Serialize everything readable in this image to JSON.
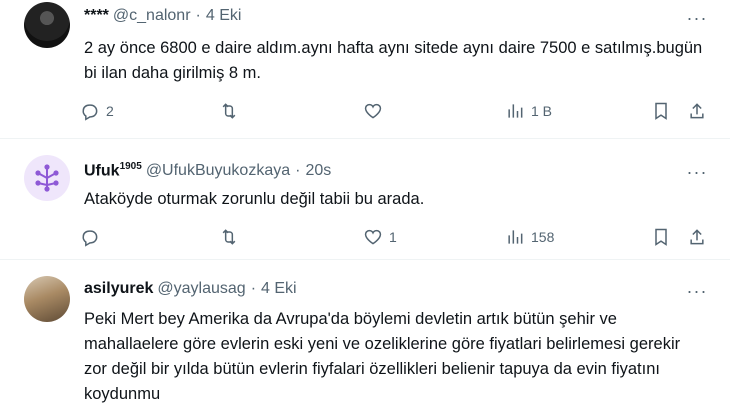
{
  "tweets": [
    {
      "name": "****",
      "handle": "@c_nalonr",
      "time": "4 Eki",
      "text": "2 ay önce 6800 e daire aldım.aynı hafta aynı sitede aynı daire 7500 e satılmış.bugün bi ilan daha girilmiş 8 m.",
      "replies": "2",
      "retweets": "",
      "likes": "",
      "views": "1 B"
    },
    {
      "name": "Ufuk",
      "name_sup": "1905",
      "handle": "@UfukBuyukozkaya",
      "time": "20s",
      "text": "Ataköyde oturmak zorunlu değil tabii bu arada.",
      "replies": "",
      "retweets": "",
      "likes": "1",
      "views": "158"
    },
    {
      "name": "asilyurek",
      "handle": "@yaylausag",
      "time": "4 Eki",
      "text": "Peki Mert bey Amerika da Avrupa'da  böylemi devletin artık bütün şehir ve mahallaelere göre evlerin eski yeni ve ozeliklerine göre fiyatlari belirlemesi gerekir zor değil bir yılda bütün evlerin fiyfalari özellikleri belienir tapuya da evin fiyatını koydunmu"
    }
  ],
  "separator_dot": "·",
  "more_glyph": "···",
  "colors": {
    "text": "#0f1419",
    "secondary": "#536471",
    "divider": "#eff3f4",
    "avatar_ufuk_bg": "#efe6fb",
    "avatar_ufuk_fg": "#8e59d6"
  },
  "icons": [
    "reply-icon",
    "retweet-icon",
    "like-icon",
    "views-icon",
    "bookmark-icon",
    "share-icon",
    "more-icon"
  ]
}
